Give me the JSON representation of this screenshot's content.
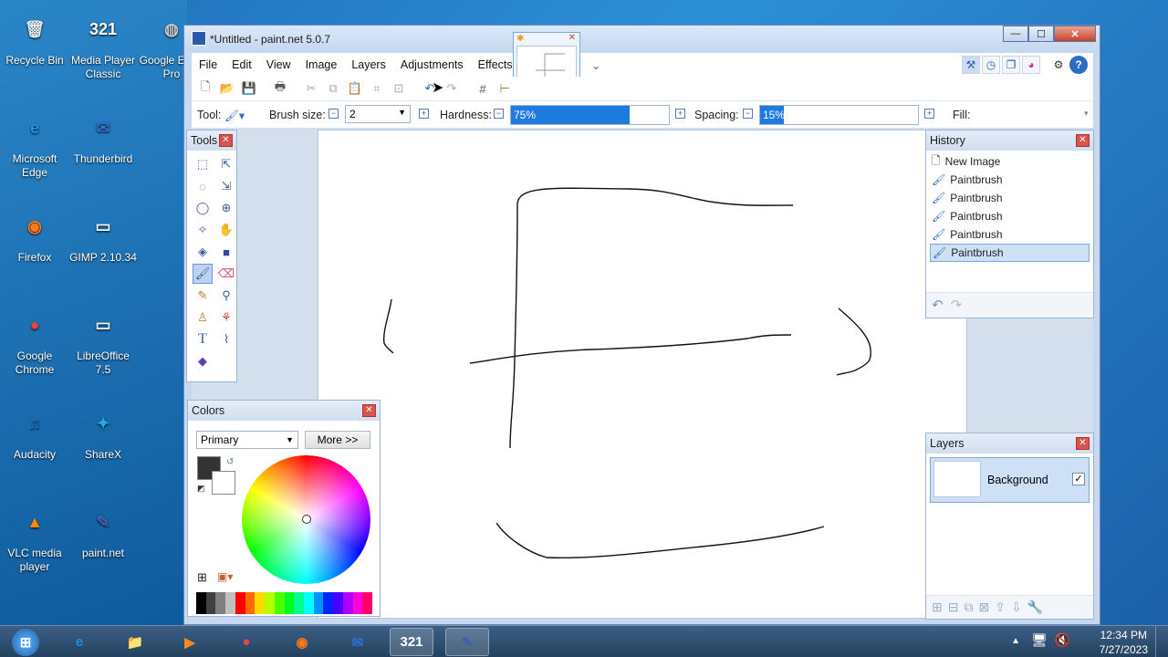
{
  "desktop": {
    "icons": [
      {
        "label": "Recycle Bin",
        "glyph": "🗑",
        "color": "#dfe7ee"
      },
      {
        "label": "Media Player Classic",
        "glyph": "321",
        "color": "#ffffff"
      },
      {
        "label": "Google Earth Pro",
        "glyph": "◍",
        "color": "#c9c9c9"
      },
      {
        "label": "Microsoft Edge",
        "glyph": "e",
        "color": "#1a9be3"
      },
      {
        "label": "Thunderbird",
        "glyph": "✉",
        "color": "#2f6fd0"
      },
      {
        "label": "Firefox",
        "glyph": "◉",
        "color": "#ff7a1a"
      },
      {
        "label": "GIMP 2.10.34",
        "glyph": "▭",
        "color": "#f2f2f2"
      },
      {
        "label": "Google Chrome",
        "glyph": "●",
        "color": "#e8453c"
      },
      {
        "label": "LibreOffice 7.5",
        "glyph": "▭",
        "color": "#f2f2f2"
      },
      {
        "label": "Audacity",
        "glyph": "♫",
        "color": "#1e66d0"
      },
      {
        "label": "ShareX",
        "glyph": "✦",
        "color": "#28a8e0"
      },
      {
        "label": "VLC media player",
        "glyph": "▲",
        "color": "#ff8a00"
      },
      {
        "label": "paint.net",
        "glyph": "✎",
        "color": "#3d5fae"
      }
    ]
  },
  "window": {
    "title": "*Untitled - paint.net 5.0.7",
    "controls": {
      "minimize": "—",
      "maximize": "☐",
      "close": "✕"
    },
    "menu": [
      "File",
      "Edit",
      "View",
      "Image",
      "Layers",
      "Adjustments",
      "Effects"
    ],
    "menu_extra": "⌄",
    "right_icons": [
      "wrench-icon",
      "history-icon",
      "layers-icon",
      "colors-icon"
    ],
    "settings_glyph": "⚙",
    "help_glyph": "?"
  },
  "toolbar": {
    "icons": [
      "📄",
      "📂",
      "💾",
      "🖨",
      "✂",
      "⧉",
      "📋",
      "⤢",
      "⊡",
      "↶",
      "↷",
      "#",
      "⊞"
    ]
  },
  "options": {
    "tool_label": "Tool:",
    "brush_label": "Brush size:",
    "brush_value": "2",
    "hardness_label": "Hardness:",
    "hardness_value": "75%",
    "hardness_pct": 75,
    "spacing_label": "Spacing:",
    "spacing_value": "15%",
    "spacing_pct": 15,
    "fill_label": "Fill:"
  },
  "tools_panel": {
    "title": "Tools",
    "close": "✕",
    "tools": [
      "▭",
      "↖",
      "◌",
      "↘",
      "◯",
      "⊕",
      "✧",
      "✋",
      "◈",
      "■",
      "🖌",
      "⌫",
      "✎",
      "⚲",
      "♙",
      "⚘",
      "T",
      "⌇",
      "◆"
    ]
  },
  "history_panel": {
    "title": "History",
    "close": "✕",
    "items": [
      "New Image",
      "Paintbrush",
      "Paintbrush",
      "Paintbrush",
      "Paintbrush",
      "Paintbrush"
    ],
    "undo": "↶",
    "redo": "↷"
  },
  "layers_panel": {
    "title": "Layers",
    "close": "✕",
    "layer_name": "Background",
    "checked": "✓",
    "footer_icons": [
      "⊞",
      "⊟",
      "⧉",
      "⊠",
      "⇪",
      "⇩",
      "🔧"
    ]
  },
  "colors_panel": {
    "title": "Colors",
    "close": "✕",
    "mode": "Primary",
    "more_button": "More >>",
    "primary_color": "#333333",
    "secondary_color": "#ffffff",
    "palette": [
      "#000000",
      "#404040",
      "#808080",
      "#c0c0c0",
      "#ff0000",
      "#ff6a00",
      "#ffd800",
      "#b6ff00",
      "#4cff00",
      "#00ff21",
      "#00ff90",
      "#00ffff",
      "#0094ff",
      "#0026ff",
      "#4800ff",
      "#b200ff",
      "#ff00dc",
      "#ff006e"
    ]
  },
  "taskbar": {
    "start_glyph": "⊞",
    "apps": [
      {
        "name": "ie",
        "glyph": "e",
        "color": "#1e8fe0"
      },
      {
        "name": "explorer",
        "glyph": "📁",
        "color": "#f5c342"
      },
      {
        "name": "media",
        "glyph": "▶",
        "color": "#f08a24"
      },
      {
        "name": "chrome",
        "glyph": "●",
        "color": "#e8453c"
      },
      {
        "name": "firefox",
        "glyph": "◉",
        "color": "#ff7a1a"
      },
      {
        "name": "thunderbird",
        "glyph": "✉",
        "color": "#2f6fd0"
      },
      {
        "name": "mpc",
        "glyph": "321",
        "color": "#ffffff"
      },
      {
        "name": "paintnet",
        "glyph": "✎",
        "color": "#3d5fae"
      }
    ],
    "time": "12:34 PM",
    "date": "7/27/2023",
    "tray_icons": [
      "▲",
      "🖥",
      "🔇"
    ]
  }
}
